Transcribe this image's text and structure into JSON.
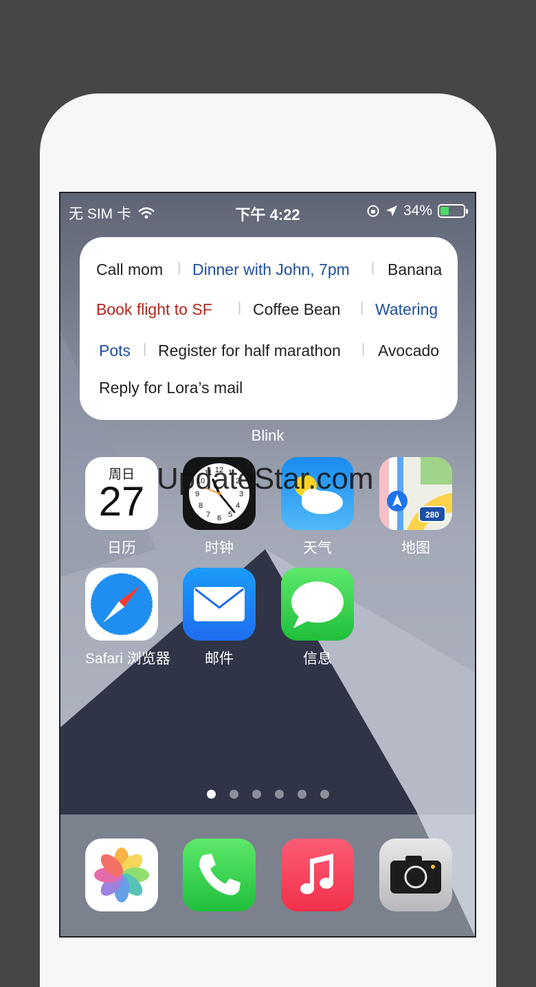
{
  "status_bar": {
    "carrier": "无 SIM 卡",
    "time": "下午 4:22",
    "battery": "34%"
  },
  "widget": {
    "name": "Blink",
    "items": [
      "Call mom",
      "Dinner with John, 7pm",
      "Banana",
      "Book flight to SF",
      "Coffee Bean",
      "Watering",
      "Pots",
      "Register for half marathon",
      "Avocado",
      "Reply for Lora’s mail"
    ]
  },
  "apps": {
    "calendar": {
      "label": "日历",
      "weekday": "周日",
      "day": "27"
    },
    "clock": {
      "label": "时钟"
    },
    "weather": {
      "label": "天气"
    },
    "maps": {
      "label": "地图",
      "route": "280"
    },
    "safari": {
      "label": "Safari 浏览器"
    },
    "mail": {
      "label": "邮件"
    },
    "messages": {
      "label": "信息"
    }
  },
  "page_dots": {
    "count": 6,
    "active_index": 0
  },
  "dock": [
    "photos-icon",
    "phone-icon",
    "music-icon",
    "camera-icon"
  ],
  "watermark": "UpdateStar.com",
  "colors": {
    "accent_blue": "#1f4fa0",
    "accent_red": "#b5261b",
    "battery_green": "#4cd964"
  }
}
